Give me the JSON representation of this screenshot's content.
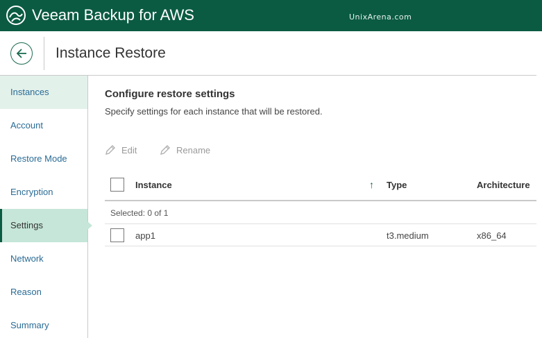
{
  "app": {
    "title": "Veeam Backup for AWS",
    "watermark": "UnixArena.com",
    "brand_color": "#0b5b42"
  },
  "header": {
    "page_title": "Instance Restore",
    "back_icon": "arrow-left-circle-icon"
  },
  "sidebar": {
    "items": [
      {
        "label": "Instances",
        "state": "done"
      },
      {
        "label": "Account",
        "state": "pending"
      },
      {
        "label": "Restore Mode",
        "state": "pending"
      },
      {
        "label": "Encryption",
        "state": "pending"
      },
      {
        "label": "Settings",
        "state": "active"
      },
      {
        "label": "Network",
        "state": "pending"
      },
      {
        "label": "Reason",
        "state": "pending"
      },
      {
        "label": "Summary",
        "state": "pending"
      }
    ]
  },
  "main": {
    "section_title": "Configure restore settings",
    "section_desc": "Specify settings for each instance that will be restored.",
    "toolbar": {
      "edit_label": "Edit",
      "rename_label": "Rename",
      "edit_icon": "pencil-icon",
      "rename_icon": "pencil-icon"
    },
    "table": {
      "columns": [
        "Instance",
        "Type",
        "Architecture"
      ],
      "sort_indicator": "↑",
      "selected_text": "Selected:  0 of 1",
      "rows": [
        {
          "instance": "app1",
          "type": "t3.medium",
          "architecture": "x86_64"
        }
      ]
    }
  }
}
